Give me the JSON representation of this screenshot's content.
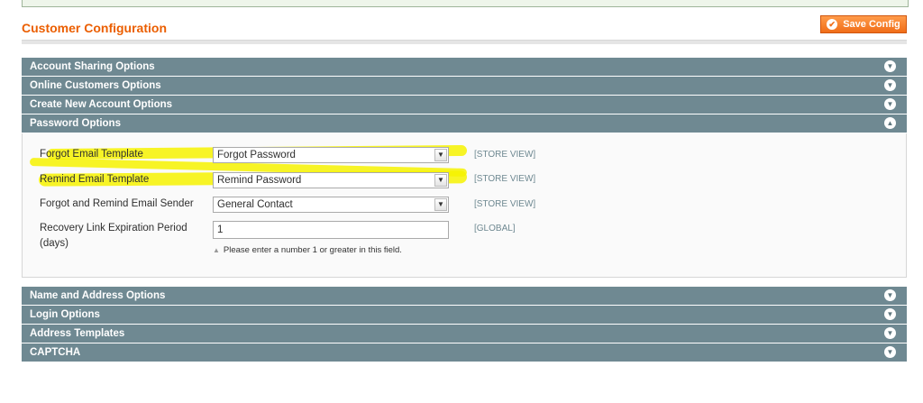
{
  "page": {
    "title": "Customer Configuration",
    "save_label": "Save Config"
  },
  "sections_before": [
    {
      "label": "Account Sharing Options",
      "icon": "expand-icon"
    },
    {
      "label": "Online Customers Options",
      "icon": "expand-icon"
    },
    {
      "label": "Create New Account Options",
      "icon": "expand-icon"
    }
  ],
  "password_options": {
    "label": "Password Options",
    "icon": "collapse-icon",
    "fields": {
      "forgot_template": {
        "label": "Forgot Email Template",
        "value": "Forgot Password",
        "scope": "[STORE VIEW]"
      },
      "remind_template": {
        "label": "Remind Email Template",
        "value": "Remind Password",
        "scope": "[STORE VIEW]"
      },
      "sender": {
        "label": "Forgot and Remind Email Sender",
        "value": "General Contact",
        "scope": "[STORE VIEW]"
      },
      "expiration": {
        "label_line1": "Recovery Link Expiration Period",
        "label_line2": "(days)",
        "value": "1",
        "hint": "Please enter a number 1 or greater in this field.",
        "scope": "[GLOBAL]"
      }
    }
  },
  "sections_after": [
    {
      "label": "Name and Address Options",
      "icon": "expand-icon"
    },
    {
      "label": "Login Options",
      "icon": "expand-icon"
    },
    {
      "label": "Address Templates",
      "icon": "expand-icon"
    },
    {
      "label": "CAPTCHA",
      "icon": "expand-icon"
    }
  ],
  "colors": {
    "title": "#eb5e00",
    "section_header": "#6f8992",
    "save_button": "#f06d18",
    "highlight": "#f6f200"
  }
}
